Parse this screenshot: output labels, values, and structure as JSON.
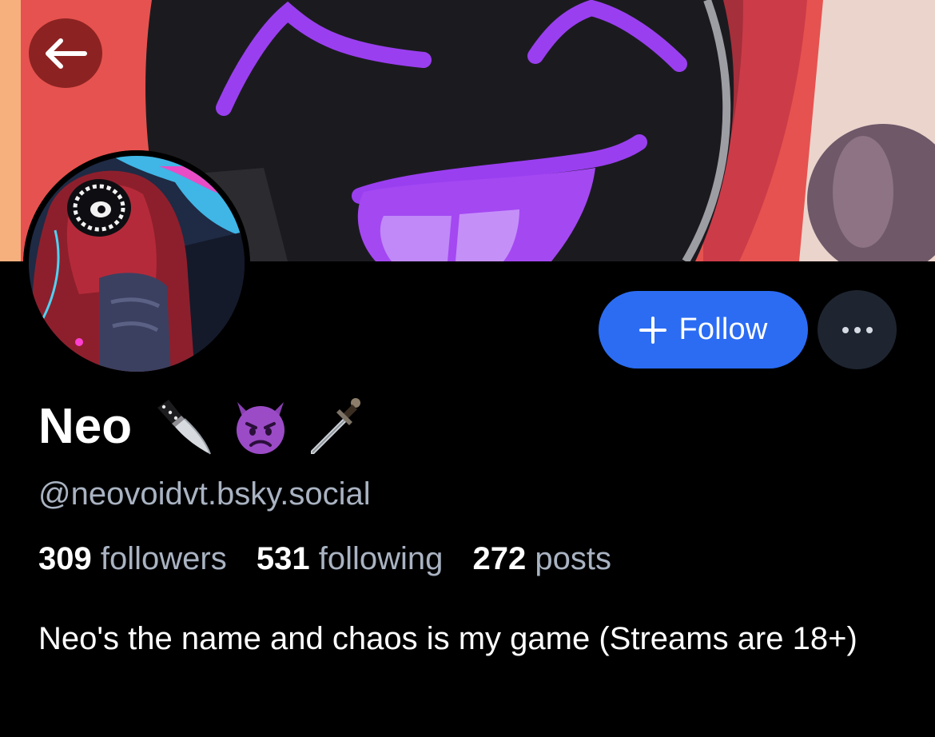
{
  "profile": {
    "display_name": "Neo",
    "name_emojis": [
      "kitchen-knife-icon",
      "smiling-imp-icon",
      "dagger-icon"
    ],
    "handle": "@neovoidvt.bsky.social",
    "stats": {
      "followers_count": "309",
      "followers_label": "followers",
      "following_count": "531",
      "following_label": "following",
      "posts_count": "272",
      "posts_label": "posts"
    },
    "bio": "Neo's the name and chaos is my game (Streams are 18+)"
  },
  "actions": {
    "follow_label": "Follow",
    "more_icon": "ellipsis-icon",
    "back_icon": "arrow-left-icon"
  },
  "colors": {
    "background": "#000000",
    "follow_button": "#2b6cf3",
    "more_button": "#1e2530",
    "muted_text": "#a9b3c2",
    "banner_red": "#e6524f",
    "banner_purple": "#9a3ff0"
  }
}
